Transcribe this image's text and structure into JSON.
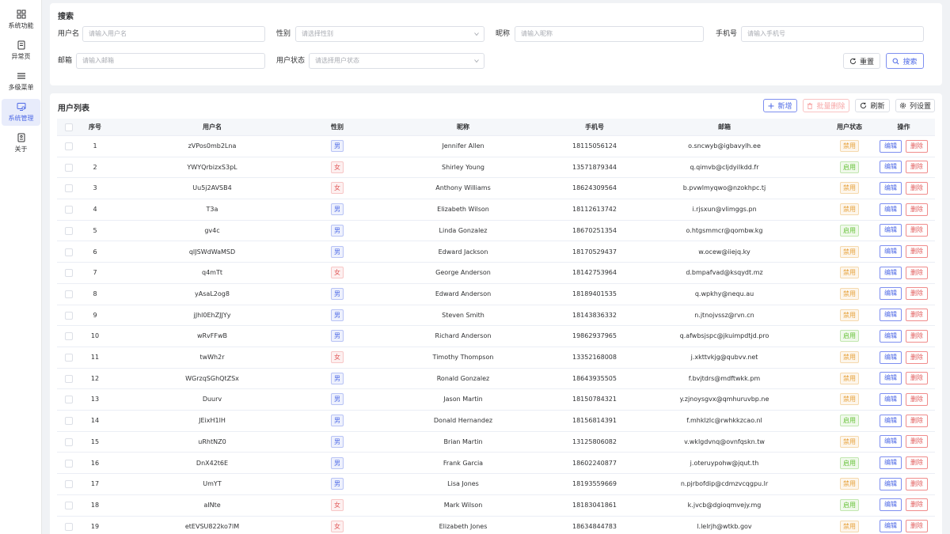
{
  "sidebar": {
    "items": [
      {
        "label": "系统功能",
        "icon": "grid-icon"
      },
      {
        "label": "异常页",
        "icon": "error-page-icon"
      },
      {
        "label": "多级菜单",
        "icon": "menu-icon"
      },
      {
        "label": "系统管理",
        "icon": "monitor-settings-icon",
        "active": true
      },
      {
        "label": "关于",
        "icon": "about-icon"
      }
    ]
  },
  "search": {
    "title": "搜索",
    "username_label": "用户名",
    "username_placeholder": "请输入用户名",
    "gender_label": "性别",
    "gender_placeholder": "请选择性别",
    "nickname_label": "昵称",
    "nickname_placeholder": "请输入昵称",
    "phone_label": "手机号",
    "phone_placeholder": "请输入手机号",
    "email_label": "邮箱",
    "email_placeholder": "请输入邮箱",
    "status_label": "用户状态",
    "status_placeholder": "请选择用户状态",
    "reset_label": "重置",
    "search_label": "搜索"
  },
  "table": {
    "title": "用户列表",
    "add_label": "新增",
    "batch_delete_label": "批量删除",
    "refresh_label": "刷新",
    "column_settings_label": "列设置",
    "columns": [
      "序号",
      "用户名",
      "性别",
      "昵称",
      "手机号",
      "邮箱",
      "用户状态",
      "操作"
    ],
    "edit_label": "编辑",
    "delete_label": "删除",
    "rows": [
      {
        "index": "1",
        "username": "zVPos0mb2Lna",
        "gender": "男",
        "nickname": "Jennifer Allen",
        "phone": "18115056124",
        "email": "o.sncwyb@igbavylh.ee",
        "status": "禁用"
      },
      {
        "index": "2",
        "username": "YWYQrbizxS3pL",
        "gender": "女",
        "nickname": "Shirley Young",
        "phone": "13571879344",
        "email": "q.qimvb@cljdyilkdd.fr",
        "status": "启用"
      },
      {
        "index": "3",
        "username": "Uu5j2AVSB4",
        "gender": "女",
        "nickname": "Anthony Williams",
        "phone": "18624309564",
        "email": "b.pvwlmyqwo@nzokhpc.tj",
        "status": "禁用"
      },
      {
        "index": "4",
        "username": "T3a",
        "gender": "男",
        "nickname": "Elizabeth Wilson",
        "phone": "18112613742",
        "email": "i.rjsxun@vlimggs.pn",
        "status": "禁用"
      },
      {
        "index": "5",
        "username": "gv4c",
        "gender": "男",
        "nickname": "Linda Gonzalez",
        "phone": "18670251354",
        "email": "o.htgsmmcr@qombw.kg",
        "status": "启用"
      },
      {
        "index": "6",
        "username": "qIJSWdWaMSD",
        "gender": "男",
        "nickname": "Edward Jackson",
        "phone": "18170529437",
        "email": "w.ocew@iiejq.ky",
        "status": "禁用"
      },
      {
        "index": "7",
        "username": "q4mTt",
        "gender": "女",
        "nickname": "George Anderson",
        "phone": "18142753964",
        "email": "d.bmpafvad@ksqydt.mz",
        "status": "禁用"
      },
      {
        "index": "8",
        "username": "yAsaL2og8",
        "gender": "男",
        "nickname": "Edward Anderson",
        "phone": "18189401535",
        "email": "q.wpkhy@nequ.au",
        "status": "禁用"
      },
      {
        "index": "9",
        "username": "jJhl0EhZJJYy",
        "gender": "男",
        "nickname": "Steven Smith",
        "phone": "18143836332",
        "email": "n.jtnojvssz@rvn.cn",
        "status": "禁用"
      },
      {
        "index": "10",
        "username": "wRvFFwB",
        "gender": "男",
        "nickname": "Richard Anderson",
        "phone": "19862937965",
        "email": "q.afwbsjspc@jkuimpdtjd.pro",
        "status": "启用"
      },
      {
        "index": "11",
        "username": "twWh2r",
        "gender": "女",
        "nickname": "Timothy Thompson",
        "phone": "13352168008",
        "email": "j.xkttvkjg@qubvv.net",
        "status": "禁用"
      },
      {
        "index": "12",
        "username": "WGrzqSGhQtZSx",
        "gender": "男",
        "nickname": "Ronald Gonzalez",
        "phone": "18643935505",
        "email": "f.bvjtdrs@mdftwkk.pm",
        "status": "禁用"
      },
      {
        "index": "13",
        "username": "Duurv",
        "gender": "男",
        "nickname": "Jason Martin",
        "phone": "18150784321",
        "email": "y.zjnoysgvx@qmhuruvbp.ne",
        "status": "禁用"
      },
      {
        "index": "14",
        "username": "JEixH1lH",
        "gender": "男",
        "nickname": "Donald Hernandez",
        "phone": "18156814391",
        "email": "f.mhklzlc@rwhkkzcao.nl",
        "status": "启用"
      },
      {
        "index": "15",
        "username": "uRhtNZ0",
        "gender": "男",
        "nickname": "Brian Martin",
        "phone": "13125806082",
        "email": "v.wklgdvnq@ovnfqskn.tw",
        "status": "禁用"
      },
      {
        "index": "16",
        "username": "DnX42t6E",
        "gender": "男",
        "nickname": "Frank Garcia",
        "phone": "18602240877",
        "email": "j.oteruypohw@jqut.th",
        "status": "启用"
      },
      {
        "index": "17",
        "username": "UmYT",
        "gender": "男",
        "nickname": "Lisa Jones",
        "phone": "18193559669",
        "email": "n.pjrbofdip@cdmzvcqgpu.lr",
        "status": "禁用"
      },
      {
        "index": "18",
        "username": "aINte",
        "gender": "女",
        "nickname": "Mark Wilson",
        "phone": "18183041861",
        "email": "k.jvcb@dgioqmvejy.mg",
        "status": "启用"
      },
      {
        "index": "19",
        "username": "etEVSU822ko7lM",
        "gender": "女",
        "nickname": "Elizabeth Jones",
        "phone": "18634844783",
        "email": "l.lelrjh@wtkb.gov",
        "status": "禁用"
      }
    ]
  },
  "colors": {
    "primary": "#4f6ae6",
    "danger": "#e15c5c",
    "warning": "#e6a23c",
    "success": "#67c23a"
  }
}
